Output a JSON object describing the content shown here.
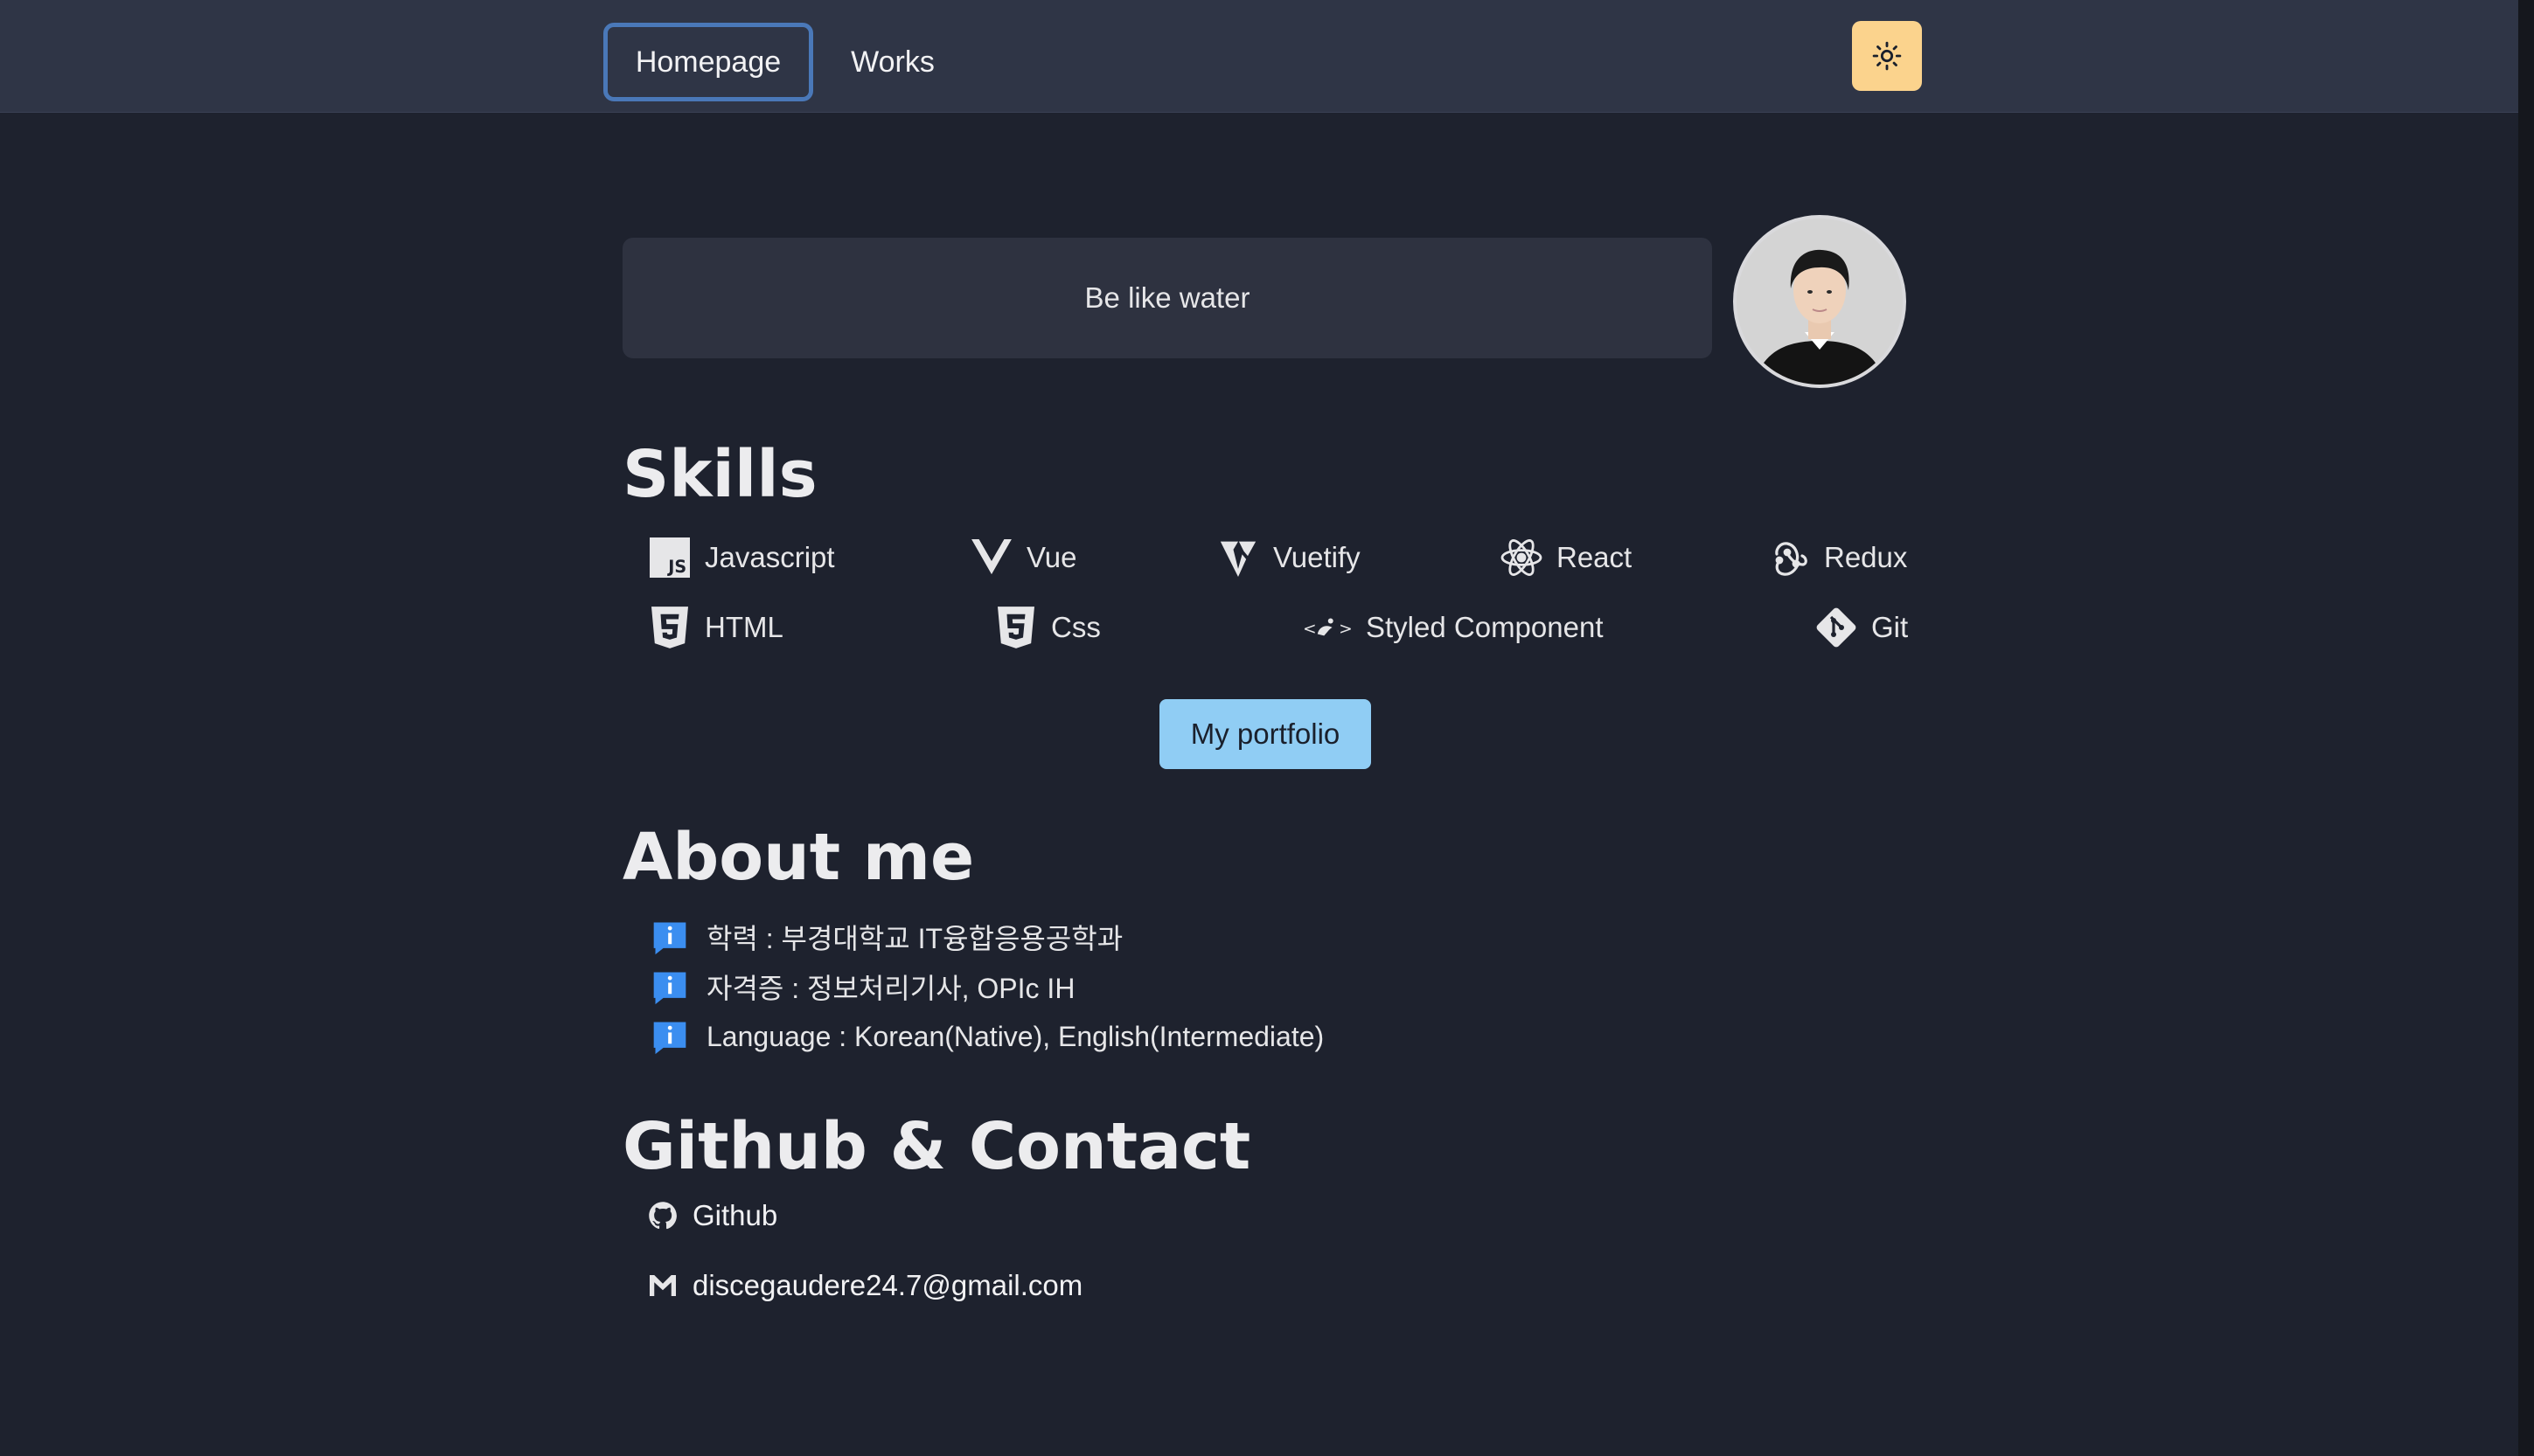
{
  "nav": {
    "home_label": "Homepage",
    "works_label": "Works",
    "theme_icon": "sun-icon"
  },
  "hero": {
    "quote": "Be like water",
    "avatar": "profile-photo"
  },
  "skills": {
    "title": "Skills",
    "items": [
      {
        "label": "Javascript",
        "icon": "javascript-icon"
      },
      {
        "label": "Vue",
        "icon": "vue-icon"
      },
      {
        "label": "Vuetify",
        "icon": "vuetify-icon"
      },
      {
        "label": "React",
        "icon": "react-icon"
      },
      {
        "label": "Redux",
        "icon": "redux-icon"
      },
      {
        "label": "HTML",
        "icon": "html5-icon"
      },
      {
        "label": "Css",
        "icon": "css3-icon"
      },
      {
        "label": "Styled Component",
        "icon": "styled-components-icon"
      },
      {
        "label": "Git",
        "icon": "git-icon"
      }
    ],
    "portfolio_button": "My portfolio"
  },
  "about": {
    "title": "About me",
    "items": [
      "학력 : 부경대학교 IT융합응용공학과",
      "자격증 : 정보처리기사, OPIc IH",
      "Language : Korean(Native), English(Intermediate)"
    ]
  },
  "contact": {
    "title": "Github & Contact",
    "github_label": "Github",
    "email": "discegaudere24.7@gmail.com"
  },
  "colors": {
    "background": "#1e222e",
    "navbar": "#2f3546",
    "accent_button": "#90cdf4",
    "theme_toggle": "#fbd38d",
    "info_icon": "#3b8ef0"
  }
}
